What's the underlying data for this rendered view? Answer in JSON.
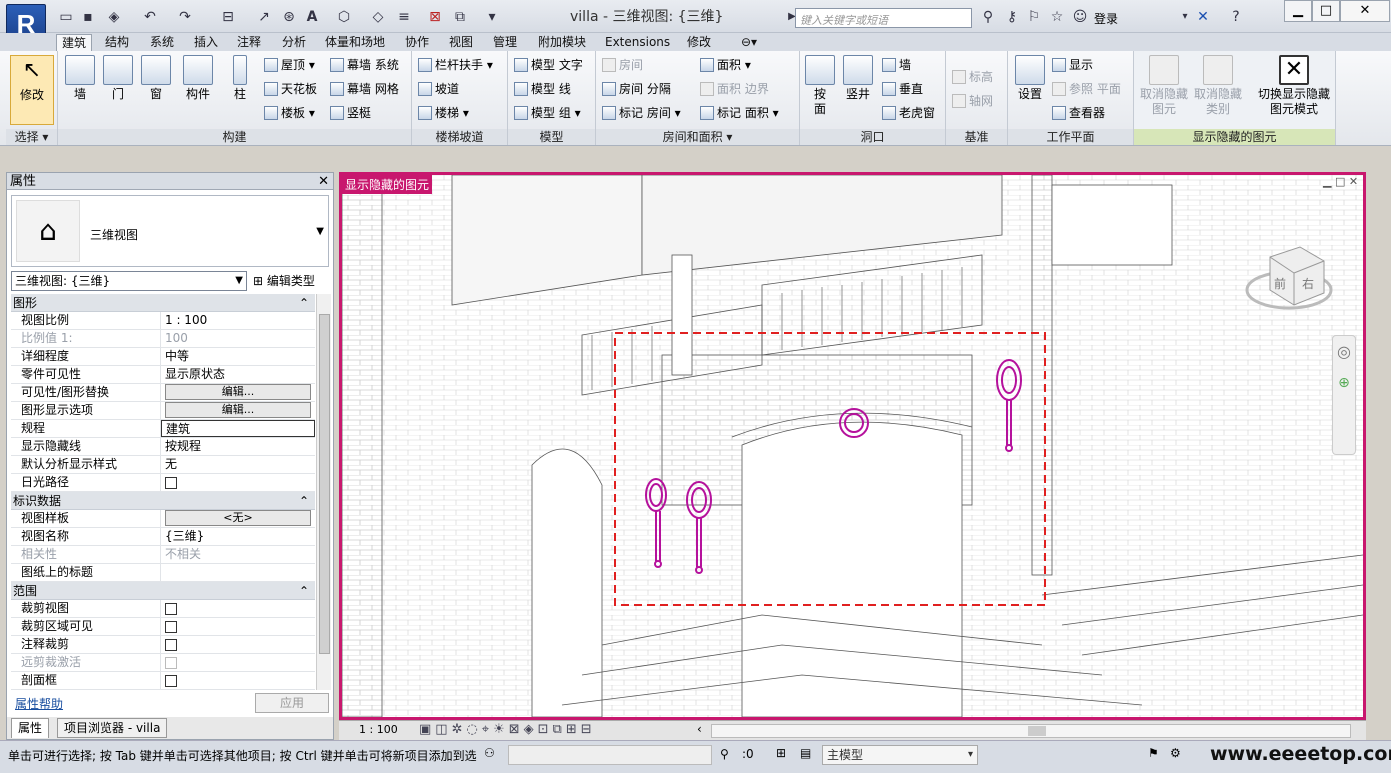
{
  "title": {
    "app": "villa - 三维视图: {三维}",
    "search_placeholder": "键入关键字或短语",
    "login": "登录"
  },
  "tabs": [
    "建筑",
    "结构",
    "系统",
    "插入",
    "注释",
    "分析",
    "体量和场地",
    "协作",
    "视图",
    "管理",
    "附加模块",
    "Extensions",
    "修改"
  ],
  "ribbon": {
    "select": {
      "modify": "修改",
      "title": "选择"
    },
    "build": {
      "wall": "墙",
      "door": "门",
      "window": "窗",
      "component": "构件",
      "column": "柱",
      "roof": "屋顶",
      "ceiling": "天花板",
      "floor": "楼板",
      "curtain_system": "幕墙 系统",
      "curtain_grid": "幕墙 网格",
      "mullion": "竖梃",
      "title": "构建"
    },
    "circulation": {
      "railing": "栏杆扶手",
      "ramp": "坡道",
      "stair": "楼梯",
      "title": "楼梯坡道"
    },
    "model": {
      "text": "模型 文字",
      "line": "模型 线",
      "group": "模型 组",
      "title": "模型"
    },
    "room": {
      "room": "房间",
      "separator": "房间 分隔",
      "tag_room": "标记 房间",
      "area": "面积",
      "area_boundary": "面积 边界",
      "tag_area": "标记 面积",
      "title": "房间和面积"
    },
    "opening": {
      "by_face": "按\n面",
      "shaft": "竖井",
      "wall": "墙",
      "vertical": "垂直",
      "dormer": "老虎窗",
      "title": "洞口"
    },
    "datum": {
      "level": "标高",
      "grid": "轴网",
      "title": "基准"
    },
    "workplane": {
      "set": "设置",
      "show": "显示",
      "ref_plane": "参照 平面",
      "viewer": "查看器",
      "title": "工作平面"
    },
    "reveal": {
      "unhide_elem": "取消隐藏\n图元",
      "unhide_cat": "取消隐藏\n类别",
      "toggle": "切换显示隐藏\n图元模式",
      "title": "显示隐藏的图元"
    }
  },
  "props": {
    "header": "属性",
    "type_name": "三维视图",
    "view_select": "三维视图: {三维}",
    "edit_type": "编辑类型",
    "rows": [
      {
        "cat": "图形"
      },
      {
        "k": "视图比例",
        "v": "1 : 100"
      },
      {
        "k": "比例值 1:",
        "v": "100",
        "dis": true
      },
      {
        "k": "详细程度",
        "v": "中等"
      },
      {
        "k": "零件可见性",
        "v": "显示原状态"
      },
      {
        "k": "可见性/图形替换",
        "btn": "编辑..."
      },
      {
        "k": "图形显示选项",
        "btn": "编辑..."
      },
      {
        "k": "规程",
        "v": "建筑",
        "boxed": true
      },
      {
        "k": "显示隐藏线",
        "v": "按规程"
      },
      {
        "k": "默认分析显示样式",
        "v": "无"
      },
      {
        "k": "日光路径",
        "cb": true
      },
      {
        "cat": "标识数据"
      },
      {
        "k": "视图样板",
        "btn": "<无>"
      },
      {
        "k": "视图名称",
        "v": "{三维}"
      },
      {
        "k": "相关性",
        "v": "不相关",
        "dis": true
      },
      {
        "k": "图纸上的标题",
        "v": ""
      },
      {
        "cat": "范围"
      },
      {
        "k": "裁剪视图",
        "cb": true
      },
      {
        "k": "裁剪区域可见",
        "cb": true
      },
      {
        "k": "注释裁剪",
        "cb": true
      },
      {
        "k": "远剪裁激活",
        "cb": true,
        "dis": true
      },
      {
        "k": "剖面框",
        "cb": true
      }
    ],
    "help": "属性帮助",
    "apply": "应用",
    "tab_props": "属性",
    "tab_browser": "项目浏览器 - villa"
  },
  "viewport": {
    "label": "显示隐藏的图元",
    "scale": "1 : 100",
    "viewcube_front": "前",
    "viewcube_right": "右"
  },
  "status": {
    "text": "单击可进行选择; 按 Tab 键并单击可选择其他项目; 按 Ctrl 键并单击可将新项目添加到选",
    "zero": ":0",
    "model": "主模型",
    "watermark": "www.eeeetop.com"
  }
}
